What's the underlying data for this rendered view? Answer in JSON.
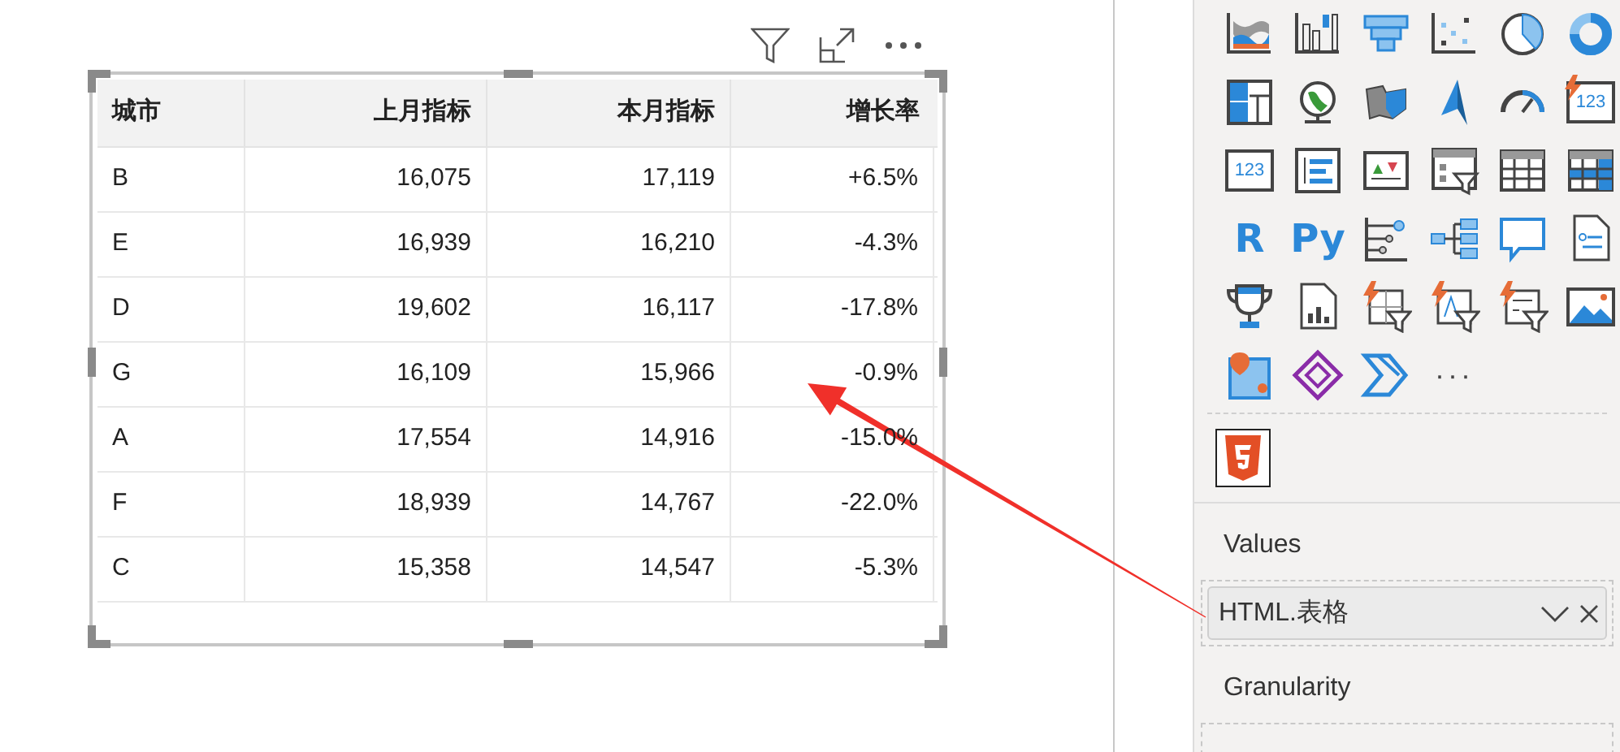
{
  "visual": {
    "header_icons": [
      {
        "kind": "filter"
      },
      {
        "kind": "focus"
      },
      {
        "kind": "more"
      }
    ],
    "table": {
      "columns": [
        {
          "label": "城市"
        },
        {
          "label": "上月指标"
        },
        {
          "label": "本月指标"
        },
        {
          "label": "增长率"
        }
      ],
      "rows": [
        [
          "B",
          "16,075",
          "17,119",
          "+6.5%"
        ],
        [
          "E",
          "16,939",
          "16,210",
          "-4.3%"
        ],
        [
          "D",
          "19,602",
          "16,117",
          "-17.8%"
        ],
        [
          "G",
          "16,109",
          "15,966",
          "-0.9%"
        ],
        [
          "A",
          "17,554",
          "14,916",
          "-15.0%"
        ],
        [
          "F",
          "18,939",
          "14,767",
          "-22.0%"
        ],
        [
          "C",
          "15,358",
          "14,547",
          "-5.3%"
        ]
      ]
    }
  },
  "visualizations_pane": {
    "visuals": [
      {
        "kind": "ribbon"
      },
      {
        "kind": "waterfall"
      },
      {
        "kind": "funnel"
      },
      {
        "kind": "scatter"
      },
      {
        "kind": "pie"
      },
      {
        "kind": "donut"
      },
      {
        "kind": "treemap"
      },
      {
        "kind": "globe"
      },
      {
        "kind": "filled-map"
      },
      {
        "kind": "azure-map"
      },
      {
        "kind": "gauge"
      },
      {
        "kind": "smart-card",
        "label": "123"
      },
      {
        "kind": "card",
        "label": "123"
      },
      {
        "kind": "multirow-card"
      },
      {
        "kind": "kpi"
      },
      {
        "kind": "slicer"
      },
      {
        "kind": "table"
      },
      {
        "kind": "matrix"
      },
      {
        "kind": "text",
        "label": "R"
      },
      {
        "kind": "text",
        "label": "Py"
      },
      {
        "kind": "influencers"
      },
      {
        "kind": "decomposition"
      },
      {
        "kind": "qa"
      },
      {
        "kind": "narrative"
      },
      {
        "kind": "trophy"
      },
      {
        "kind": "paginated"
      },
      {
        "kind": "smart-slicer"
      },
      {
        "kind": "smart-text-slicer"
      },
      {
        "kind": "smart-list-slicer"
      },
      {
        "kind": "image"
      },
      {
        "kind": "arcgis"
      },
      {
        "kind": "powerapps"
      },
      {
        "kind": "automate"
      },
      {
        "kind": "more",
        "label": "···"
      }
    ],
    "custom_visuals": [
      {
        "kind": "html5",
        "selected": true
      }
    ],
    "wells": [
      {
        "title": "Values",
        "fields": [
          {
            "label": "HTML.表格"
          }
        ]
      },
      {
        "title": "Granularity"
      }
    ]
  }
}
